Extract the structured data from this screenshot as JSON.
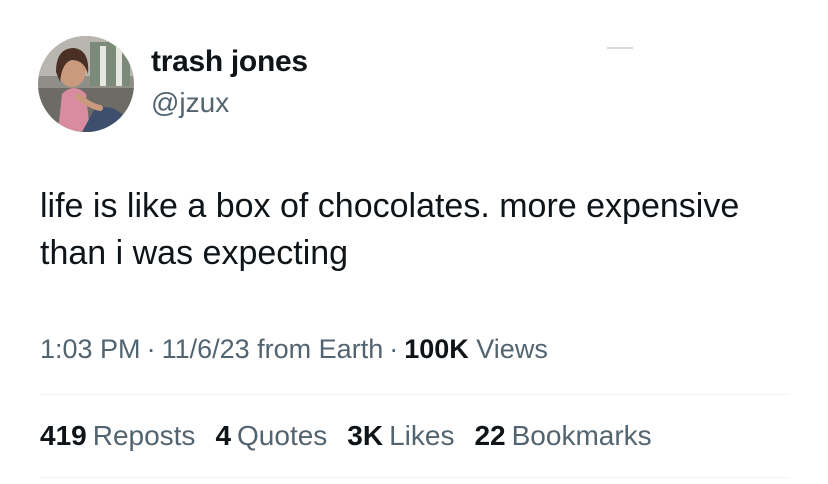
{
  "author": {
    "display_name": "trash jones",
    "handle": "@jzux"
  },
  "tweet": {
    "text": "life is like a box of chocolates. more expensive than i was expecting"
  },
  "meta": {
    "time": "1:03 PM",
    "separator": "·",
    "date": "11/6/23",
    "source": "from Earth",
    "views_count": "100K",
    "views_label": "Views"
  },
  "stats": [
    {
      "count": "419",
      "label": "Reposts"
    },
    {
      "count": "4",
      "label": "Quotes"
    },
    {
      "count": "3K",
      "label": "Likes"
    },
    {
      "count": "22",
      "label": "Bookmarks"
    }
  ]
}
